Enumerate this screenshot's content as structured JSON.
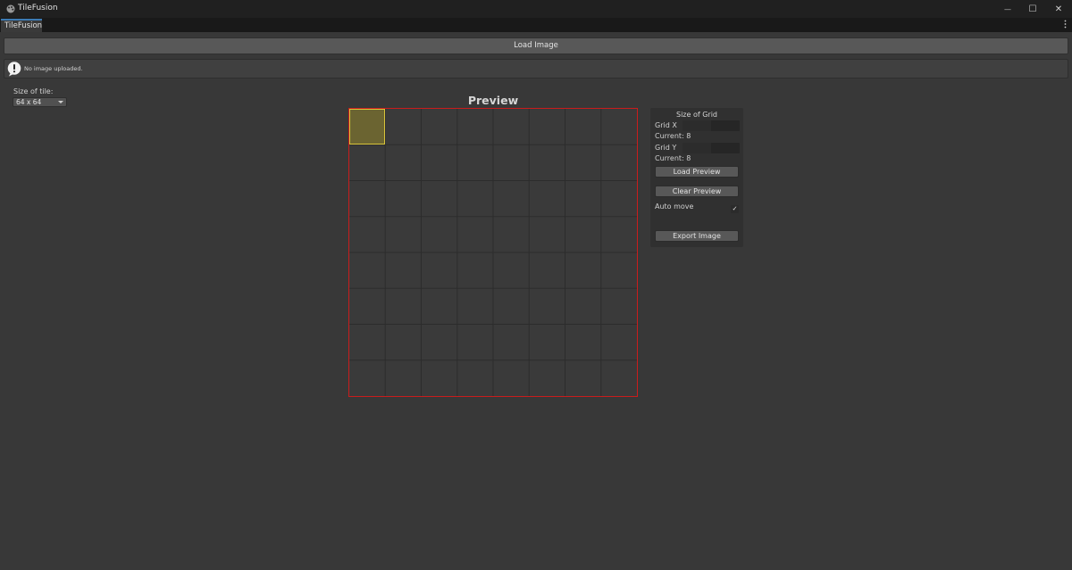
{
  "window": {
    "title": "TileFusion",
    "controls": {
      "minimize": "—",
      "maximize": "☐",
      "close": "✕"
    }
  },
  "tabs": [
    {
      "label": "TileFusion"
    }
  ],
  "toolbar": {
    "load_image_label": "Load Image"
  },
  "helpbox": {
    "message": "No image uploaded."
  },
  "tile_size": {
    "label": "Size of tile:",
    "selected": "64 x 64"
  },
  "preview": {
    "title": "Preview",
    "grid_columns": 8,
    "grid_rows": 8,
    "colors": {
      "border": "#c91c1c",
      "selected_fill": "#6b6431",
      "selected_border": "#d8c43a"
    }
  },
  "grid_panel": {
    "title": "Size of Grid",
    "grid_x_label": "Grid X",
    "grid_x_current": "Current: 8",
    "grid_y_label": "Grid Y",
    "grid_y_current": "Current: 8",
    "load_preview_label": "Load Preview",
    "clear_preview_label": "Clear Preview",
    "auto_move_label": "Auto move",
    "auto_move_checked": true,
    "check_glyph": "✓",
    "export_image_label": "Export Image"
  },
  "icons": {
    "app": "palette-icon",
    "info": "info-speech-icon",
    "menu": "kebab-menu-icon",
    "dropdown": "chevron-down-icon"
  }
}
